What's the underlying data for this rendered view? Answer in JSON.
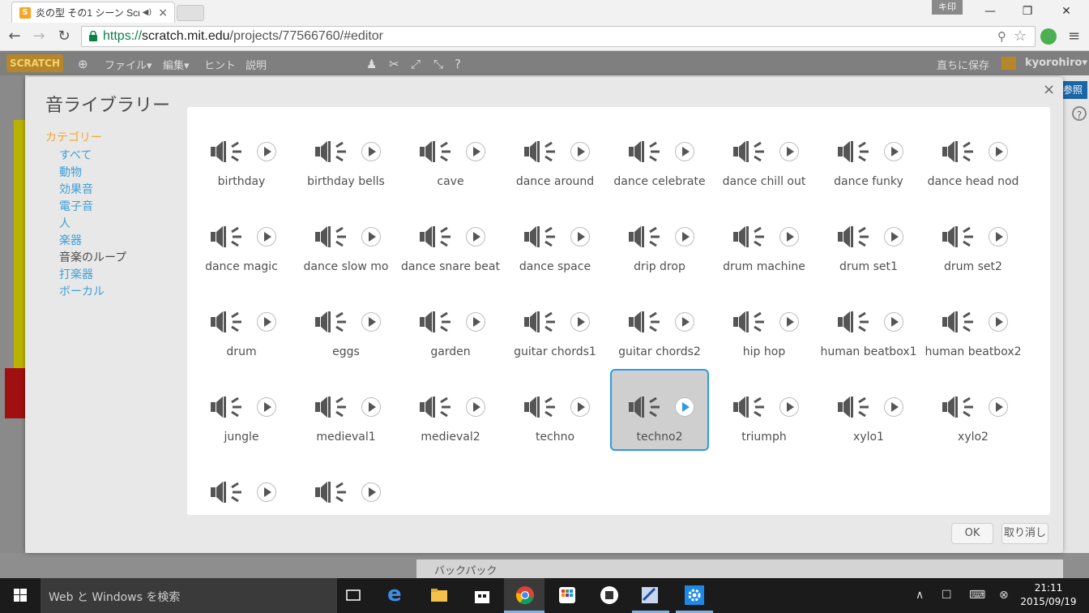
{
  "browser": {
    "tab_title": "炎の型 その1 シーン Scrat",
    "user_badge": "キ印",
    "url_scheme": "https://",
    "url_host": "scratch.mit.edu",
    "url_path": "/projects/77566760/#editor"
  },
  "scratch_menu": {
    "logo": "SCRATCH",
    "file": "ファイル▾",
    "edit": "編集▾",
    "tips": "ヒント",
    "about": "説明",
    "save_now": "直ちに保存",
    "username": "kyorohiro▾",
    "see_inside": "参照",
    "backpack": "バックパック"
  },
  "dialog": {
    "title": "音ライブラリー",
    "close": "×",
    "category_header": "カテゴリー",
    "categories": [
      {
        "label": "すべて",
        "selected": false
      },
      {
        "label": "動物",
        "selected": false
      },
      {
        "label": "効果音",
        "selected": false
      },
      {
        "label": "電子音",
        "selected": false
      },
      {
        "label": "人",
        "selected": false
      },
      {
        "label": "楽器",
        "selected": false
      },
      {
        "label": "音楽のループ",
        "selected": true
      },
      {
        "label": "打楽器",
        "selected": false
      },
      {
        "label": "ボーカル",
        "selected": false
      }
    ],
    "sounds": [
      {
        "name": "birthday"
      },
      {
        "name": "birthday bells"
      },
      {
        "name": "cave"
      },
      {
        "name": "dance around"
      },
      {
        "name": "dance celebrate"
      },
      {
        "name": "dance chill out"
      },
      {
        "name": "dance funky"
      },
      {
        "name": "dance head nod"
      },
      {
        "name": "dance magic"
      },
      {
        "name": "dance slow mo"
      },
      {
        "name": "dance snare beat"
      },
      {
        "name": "dance space"
      },
      {
        "name": "drip drop"
      },
      {
        "name": "drum machine"
      },
      {
        "name": "drum set1"
      },
      {
        "name": "drum set2"
      },
      {
        "name": "drum"
      },
      {
        "name": "eggs"
      },
      {
        "name": "garden"
      },
      {
        "name": "guitar chords1"
      },
      {
        "name": "guitar chords2"
      },
      {
        "name": "hip hop"
      },
      {
        "name": "human beatbox1"
      },
      {
        "name": "human beatbox2"
      },
      {
        "name": "jungle"
      },
      {
        "name": "medieval1"
      },
      {
        "name": "medieval2"
      },
      {
        "name": "techno"
      },
      {
        "name": "techno2",
        "selected": true
      },
      {
        "name": "triumph"
      },
      {
        "name": "xylo1"
      },
      {
        "name": "xylo2"
      },
      {
        "name": ""
      },
      {
        "name": ""
      }
    ],
    "ok_label": "OK",
    "cancel_label": "取り消し"
  },
  "taskbar": {
    "search_placeholder": "Web と Windows を検索",
    "time": "21:11",
    "date": "2015/09/19"
  },
  "colors": {
    "accent": "#2d9be3",
    "category_link": "#3ea0d6",
    "category_header": "#f4a531"
  }
}
